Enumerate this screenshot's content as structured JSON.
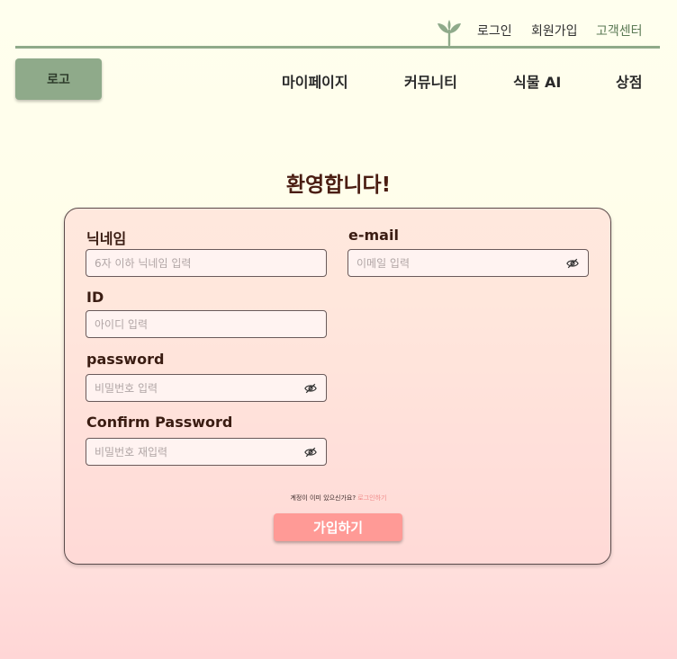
{
  "header": {
    "links": {
      "login": "로그인",
      "signup": "회원가입",
      "support": "고객센터"
    },
    "logo_label": "로고",
    "nav": {
      "mypage": "마이페이지",
      "community": "커뮤니티",
      "plant_ai": "식물 AI",
      "shop": "상점"
    }
  },
  "page_title": "환영합니다!",
  "form": {
    "nickname": {
      "label": "닉네임",
      "placeholder": "6자 이하 닉네임 입력"
    },
    "email": {
      "label": "e-mail",
      "placeholder": "이메일 입력"
    },
    "id": {
      "label": "ID",
      "placeholder": "아이디 입력"
    },
    "password": {
      "label": "password",
      "placeholder": "비밀번호 입력"
    },
    "confirm_password": {
      "label": "Confirm Password",
      "placeholder": "비밀번호 재입력"
    },
    "login_hint": "계정이 이미 있으신가요?",
    "login_link": "로그인하기",
    "submit_label": "가입하기"
  },
  "icons": {
    "brand": "sprout-icon",
    "toggle_visibility": "eye-off-icon"
  },
  "colors": {
    "accent_green": "#8FAA8A",
    "submit_pink": "#FF9A96",
    "title_brown": "#4A1D12",
    "link_pink": "#F08A8A"
  }
}
